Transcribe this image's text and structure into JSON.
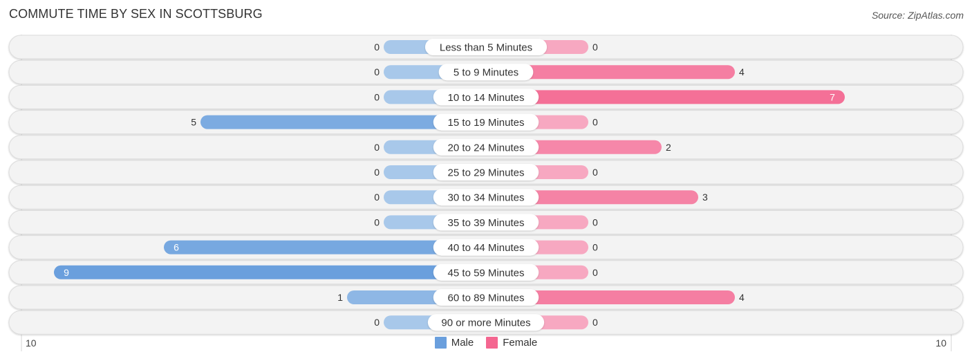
{
  "header": {
    "title": "COMMUTE TIME BY SEX IN SCOTTSBURG",
    "source": "Source: ZipAtlas.com"
  },
  "colors": {
    "male": "#6a9fdd",
    "male_light": "#a8c8ea",
    "female": "#f46690",
    "female_light": "#f7a8c1",
    "track": "#f3f3f3"
  },
  "chart_data": {
    "type": "bar",
    "orientation": "horizontal-diverging",
    "title": "COMMUTE TIME BY SEX IN SCOTTSBURG",
    "categories": [
      "Less than 5 Minutes",
      "5 to 9 Minutes",
      "10 to 14 Minutes",
      "15 to 19 Minutes",
      "20 to 24 Minutes",
      "25 to 29 Minutes",
      "30 to 34 Minutes",
      "35 to 39 Minutes",
      "40 to 44 Minutes",
      "45 to 59 Minutes",
      "60 to 89 Minutes",
      "90 or more Minutes"
    ],
    "series": [
      {
        "name": "Male",
        "values": [
          0,
          0,
          0,
          5,
          0,
          0,
          0,
          0,
          6,
          9,
          1,
          0
        ]
      },
      {
        "name": "Female",
        "values": [
          0,
          4,
          7,
          0,
          2,
          0,
          3,
          0,
          0,
          0,
          4,
          0
        ]
      }
    ],
    "axis": {
      "left_label": "10",
      "right_label": "10",
      "range": [
        -10,
        10
      ]
    },
    "legend": {
      "position": "bottom-center",
      "items": [
        "Male",
        "Female"
      ]
    }
  }
}
